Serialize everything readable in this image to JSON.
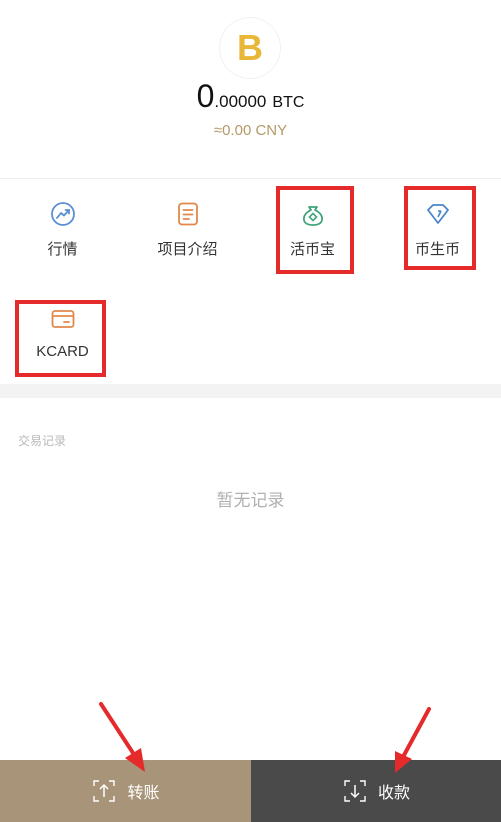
{
  "header": {
    "coin_symbol": "B",
    "balance_integer": "0",
    "balance_decimals": ".00000",
    "coin_unit": "BTC",
    "fiat_value": "≈0.00 CNY"
  },
  "menu": {
    "items": [
      {
        "label": "行情",
        "icon": "chart-trend-icon"
      },
      {
        "label": "项目介绍",
        "icon": "document-icon"
      },
      {
        "label": "活币宝",
        "icon": "money-bag-icon"
      },
      {
        "label": "币生币",
        "icon": "diamond-icon"
      },
      {
        "label": "KCARD",
        "icon": "card-icon"
      }
    ]
  },
  "records": {
    "title": "交易记录",
    "empty_text": "暂无记录"
  },
  "bottom": {
    "transfer_label": "转账",
    "receive_label": "收款"
  },
  "colors": {
    "coin_gold": "#e8b737",
    "fiat_gold": "#b39a66",
    "transfer_bg": "#a89478",
    "receive_bg": "#4a4a4a",
    "highlight_red": "#e42a2a"
  }
}
